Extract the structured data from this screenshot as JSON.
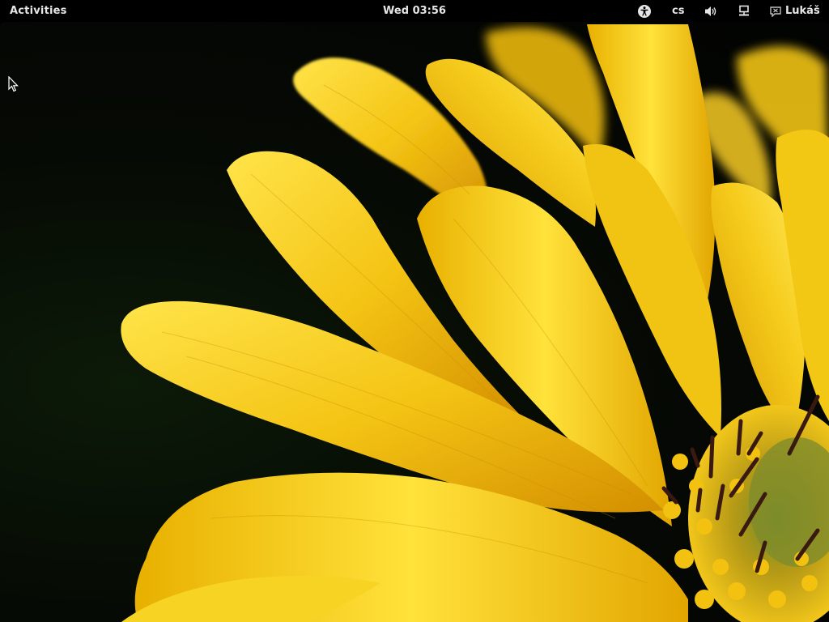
{
  "topbar": {
    "activities_label": "Activities",
    "clock": "Wed 03:56",
    "language": "cs",
    "user_name": "Lukáš"
  },
  "icons": {
    "accessibility": "accessibility-icon",
    "volume": "volume-icon",
    "network": "network-icon",
    "user": "user-status-icon",
    "cursor": "mouse-pointer-icon"
  },
  "colors": {
    "topbar_bg": "#000000",
    "topbar_text": "#e6e6e6",
    "petal_yellow": "#f7d21a",
    "petal_shadow": "#d99a00",
    "stamen": "#3a1a10"
  }
}
